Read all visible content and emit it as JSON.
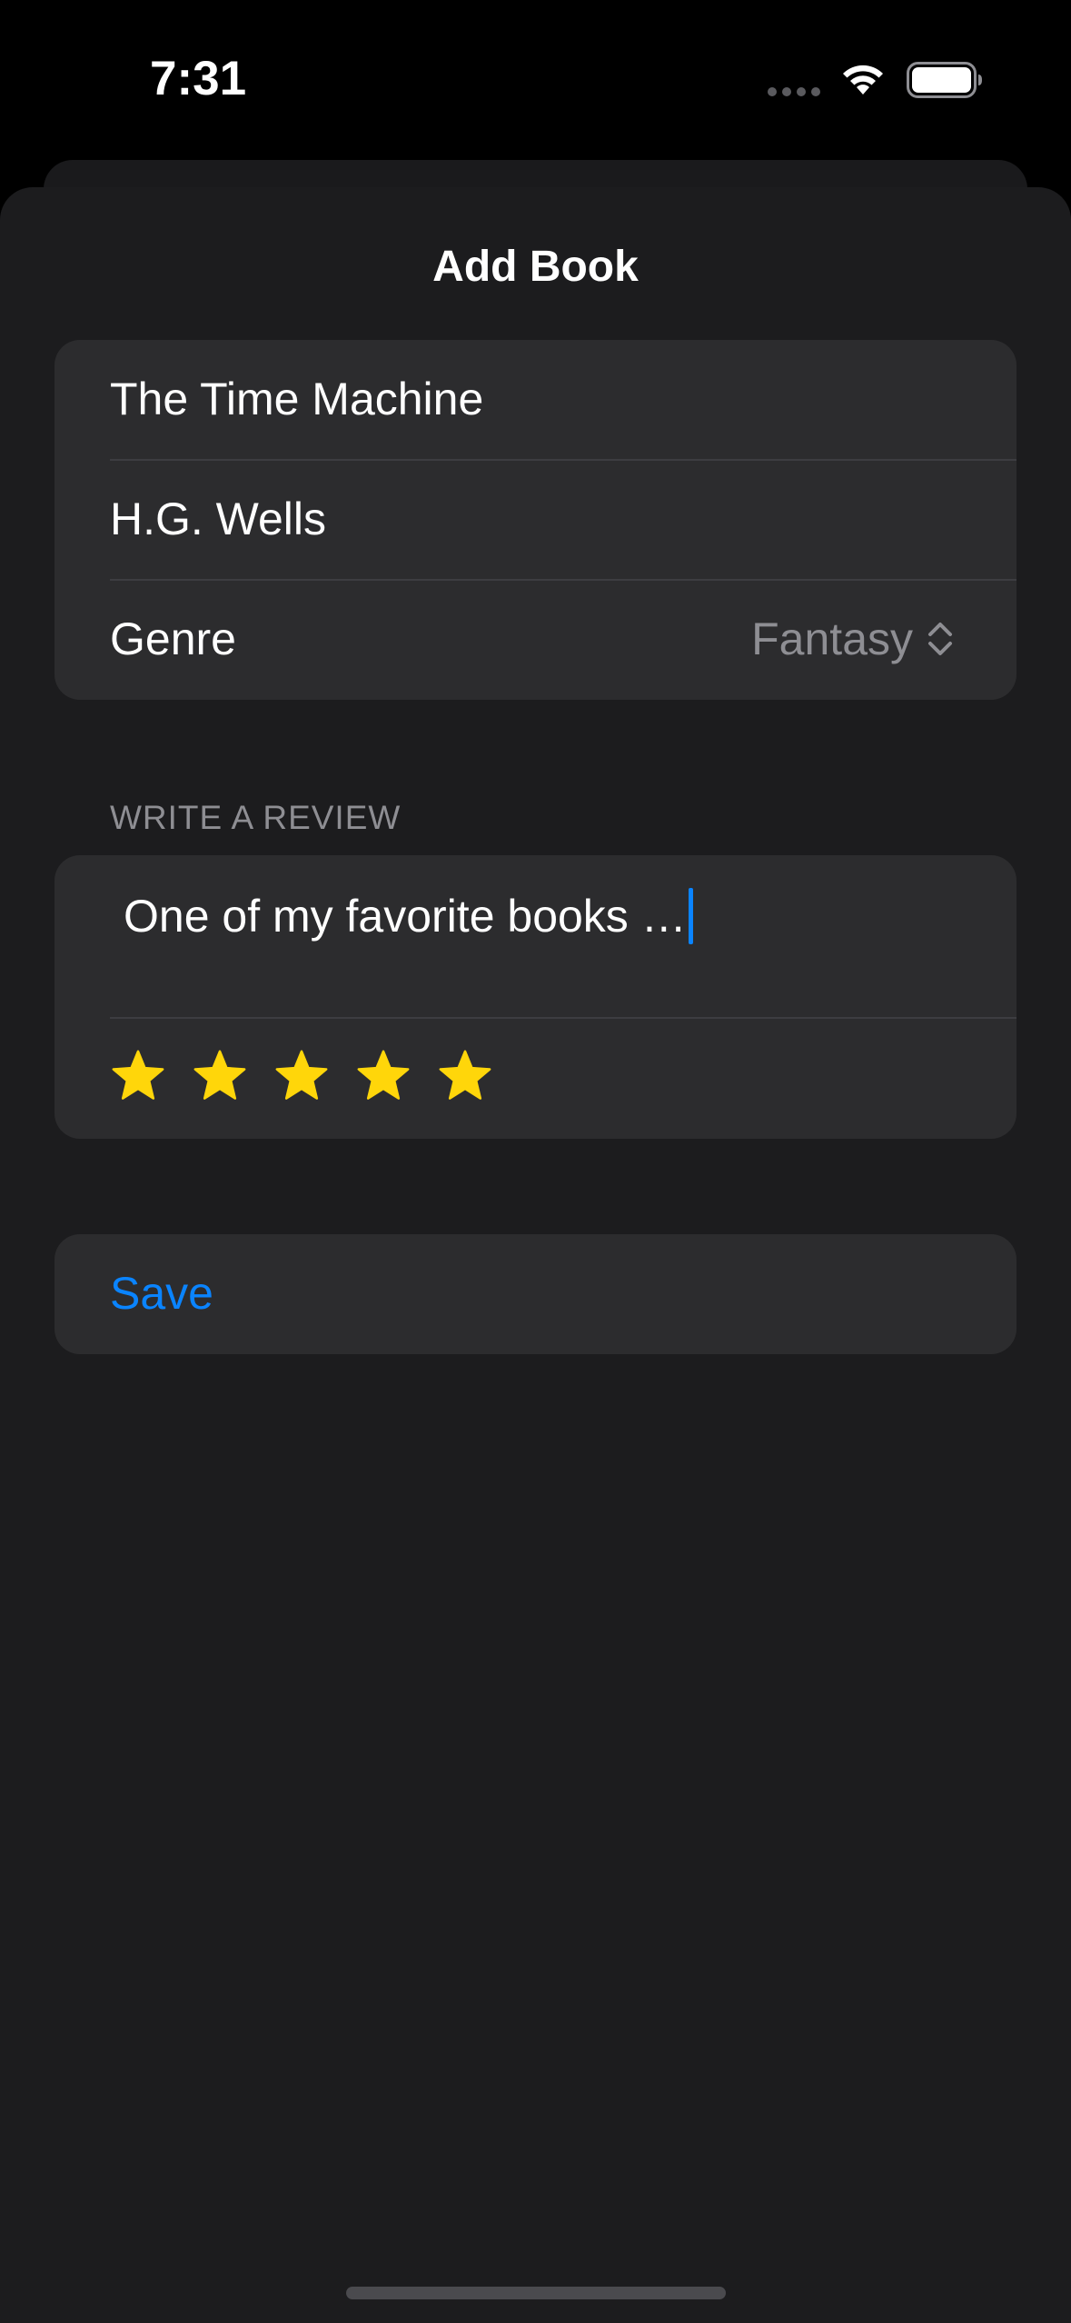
{
  "status_bar": {
    "time": "7:31"
  },
  "sheet": {
    "title": "Add Book"
  },
  "book_form": {
    "title_value": "The Time Machine",
    "author_value": "H.G. Wells",
    "genre_label": "Genre",
    "genre_value": "Fantasy"
  },
  "review": {
    "section_header": "WRITE A REVIEW",
    "text_value": "One of my favorite books …",
    "rating": 5,
    "rating_max": 5
  },
  "actions": {
    "save_label": "Save"
  },
  "colors": {
    "accent": "#0a84ff",
    "star": "#ffd60a",
    "background": "#1c1c1e",
    "card": "#2c2c2e",
    "secondary_text": "#8e8e93"
  },
  "icons": {
    "wifi": "wifi-icon",
    "battery": "battery-icon",
    "genre_picker": "chevron-up-down-icon",
    "rating": "star-filled-icon"
  }
}
